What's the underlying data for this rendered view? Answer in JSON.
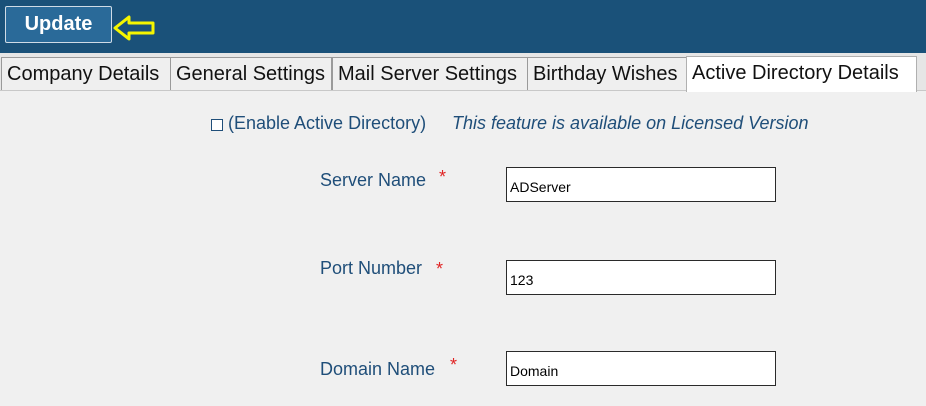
{
  "toolbar": {
    "update_label": "Update",
    "arrow_icon": "arrow-left-icon",
    "arrow_color": "#f5f500",
    "bar_color": "#1a5179"
  },
  "tabs": [
    {
      "label": "Company Details",
      "active": false
    },
    {
      "label": "General Settings",
      "active": false
    },
    {
      "label": "Mail Server Settings",
      "active": false
    },
    {
      "label": "Birthday Wishes",
      "active": false
    },
    {
      "label": "Active Directory Details",
      "active": true
    }
  ],
  "active_directory": {
    "enable_label": "(Enable Active Directory)",
    "enable_checked": false,
    "licensed_note": "This feature is available on Licensed Version",
    "required_marker": "*",
    "fields": [
      {
        "label": "Server Name",
        "value": "ADServer"
      },
      {
        "label": "Port Number",
        "value": "123"
      },
      {
        "label": "Domain Name",
        "value": "Domain"
      }
    ]
  }
}
